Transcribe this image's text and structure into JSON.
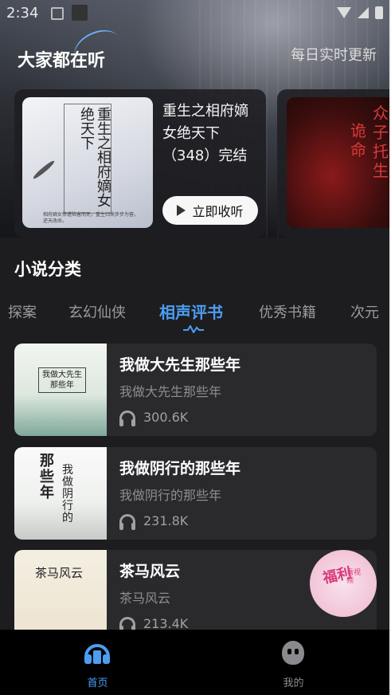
{
  "status_bar": {
    "time": "2:34"
  },
  "hero": {
    "title": "大家都在听",
    "update_label": "每日实时更新"
  },
  "featured": [
    {
      "cover_title": "重生之相府嫡女绝天下",
      "cover_small": "相府嫡女惨遭陷害而死，重生归来步步为营，逆天改命。",
      "title": "重生之相府嫡女绝天下（348）完结",
      "listen_label": "立即收听"
    },
    {
      "cover_text_1": "诡命",
      "cover_text_2": "众子托生"
    }
  ],
  "section": {
    "title": "小说分类"
  },
  "tabs": [
    {
      "label": "探案",
      "active": false
    },
    {
      "label": "玄幻仙侠",
      "active": false
    },
    {
      "label": "相声评书",
      "active": true
    },
    {
      "label": "优秀书籍",
      "active": false
    },
    {
      "label": "次元",
      "active": false
    }
  ],
  "list": [
    {
      "title": "我做大先生那些年",
      "subtitle": "我做大先生那些年",
      "plays": "300.6K",
      "cover_text": "我做大先生那些年"
    },
    {
      "title": "我做阴行的那些年",
      "subtitle": "我做阴行的那些年",
      "plays": "231.8K",
      "cover_text_1": "那些年",
      "cover_text_2": "我做阴行的"
    },
    {
      "title": "茶马风云",
      "subtitle": "茶马风云",
      "plays": "213.4K",
      "cover_text": "茶马风云"
    }
  ],
  "float_badge": {
    "text": "福利",
    "small": "看视频"
  },
  "bottom_nav": [
    {
      "label": "首页",
      "active": true,
      "icon": "headphones-icon"
    },
    {
      "label": "我的",
      "active": false,
      "icon": "mine-face-icon"
    }
  ],
  "colors": {
    "accent": "#4c9df2",
    "card_bg": "#2a2a2d",
    "page_bg": "#1d1d1f"
  }
}
